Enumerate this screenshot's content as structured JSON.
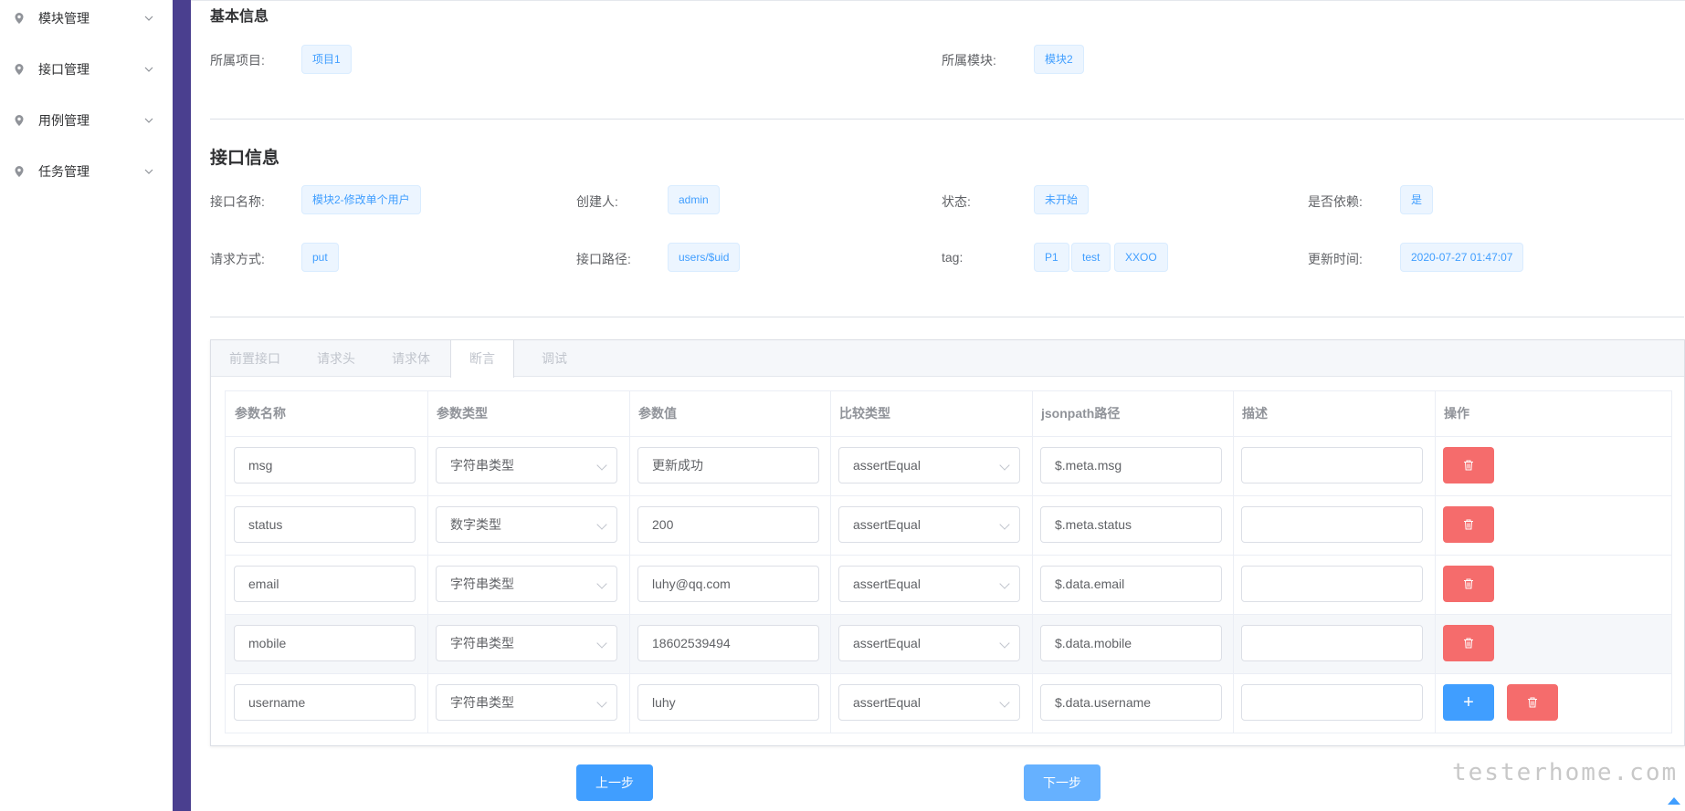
{
  "sidebar": {
    "items": [
      {
        "label": "模块管理"
      },
      {
        "label": "接口管理"
      },
      {
        "label": "用例管理"
      },
      {
        "label": "任务管理"
      }
    ]
  },
  "basic_info": {
    "title": "基本信息",
    "project_label": "所属项目:",
    "project_value": "项目1",
    "module_label": "所属模块:",
    "module_value": "模块2"
  },
  "api_info": {
    "title": "接口信息",
    "name_label": "接口名称:",
    "name_value": "模块2-修改单个用户",
    "creator_label": "创建人:",
    "creator_value": "admin",
    "status_label": "状态:",
    "status_value": "未开始",
    "dependent_label": "是否依赖:",
    "dependent_value": "是",
    "method_label": "请求方式:",
    "method_value": "put",
    "path_label": "接口路径:",
    "path_value": "users/$uid",
    "tag_label": "tag:",
    "tags": [
      "P1",
      "test",
      "XXOO"
    ],
    "updated_label": "更新时间:",
    "updated_value": "2020-07-27 01:47:07"
  },
  "tabs": [
    {
      "label": "前置接口"
    },
    {
      "label": "请求头"
    },
    {
      "label": "请求体"
    },
    {
      "label": "断言"
    },
    {
      "label": "调试"
    }
  ],
  "table": {
    "headers": [
      "参数名称",
      "参数类型",
      "参数值",
      "比较类型",
      "jsonpath路径",
      "描述",
      "操作"
    ],
    "rows": [
      {
        "name": "msg",
        "type": "字符串类型",
        "value": "更新成功",
        "compare": "assertEqual",
        "path": "$.meta.msg",
        "desc": ""
      },
      {
        "name": "status",
        "type": "数字类型",
        "value": "200",
        "compare": "assertEqual",
        "path": "$.meta.status",
        "desc": ""
      },
      {
        "name": "email",
        "type": "字符串类型",
        "value": "luhy@qq.com",
        "compare": "assertEqual",
        "path": "$.data.email",
        "desc": ""
      },
      {
        "name": "mobile",
        "type": "字符串类型",
        "value": "18602539494",
        "compare": "assertEqual",
        "path": "$.data.mobile",
        "desc": ""
      },
      {
        "name": "username",
        "type": "字符串类型",
        "value": "luhy",
        "compare": "assertEqual",
        "path": "$.data.username",
        "desc": ""
      }
    ],
    "add_label": "+"
  },
  "footer": {
    "prev_label": "上一步",
    "next_label": "下一步",
    "watermark": "testerhome.com"
  },
  "colors": {
    "accent": "#409eff",
    "danger": "#f56c6c",
    "sidebar_bar": "#4a3f8f"
  }
}
